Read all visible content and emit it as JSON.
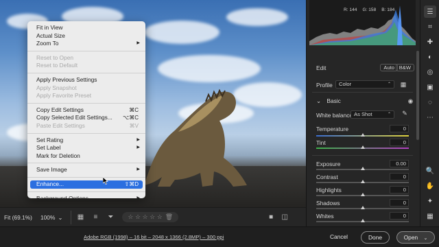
{
  "canvas_bar": {
    "fit_label": "Fit (69.1%)",
    "zoom_label": "100%",
    "rating_stars": "☆ ☆ ☆ ☆ ☆"
  },
  "context_menu": {
    "items": [
      {
        "label": "Fit in View",
        "shortcut": "",
        "submenu": false,
        "disabled": false
      },
      {
        "label": "Actual Size",
        "shortcut": "",
        "submenu": false,
        "disabled": false
      },
      {
        "label": "Zoom To",
        "shortcut": "",
        "submenu": true,
        "disabled": false
      },
      {
        "label": "Reset to Open",
        "shortcut": "",
        "submenu": false,
        "disabled": true
      },
      {
        "label": "Reset to Default",
        "shortcut": "",
        "submenu": false,
        "disabled": true
      },
      {
        "label": "Apply Previous Settings",
        "shortcut": "",
        "submenu": false,
        "disabled": false
      },
      {
        "label": "Apply Snapshot",
        "shortcut": "",
        "submenu": false,
        "disabled": true
      },
      {
        "label": "Apply Favorite Preset",
        "shortcut": "",
        "submenu": false,
        "disabled": true
      },
      {
        "label": "Copy Edit Settings",
        "shortcut": "⌘C",
        "submenu": false,
        "disabled": false
      },
      {
        "label": "Copy Selected Edit Settings...",
        "shortcut": "⌥⌘C",
        "submenu": false,
        "disabled": false
      },
      {
        "label": "Paste Edit Settings",
        "shortcut": "⌘V",
        "submenu": false,
        "disabled": true
      },
      {
        "label": "Set Rating",
        "shortcut": "",
        "submenu": true,
        "disabled": false
      },
      {
        "label": "Set Label",
        "shortcut": "",
        "submenu": true,
        "disabled": false
      },
      {
        "label": "Mark for Deletion",
        "shortcut": "",
        "submenu": false,
        "disabled": false
      },
      {
        "label": "Save Image",
        "shortcut": "",
        "submenu": true,
        "disabled": false
      },
      {
        "label": "Enhance...",
        "shortcut": "⇧⌘D",
        "submenu": false,
        "disabled": false,
        "highlighted": true
      },
      {
        "label": "Background Options",
        "shortcut": "",
        "submenu": true,
        "disabled": false
      }
    ]
  },
  "histogram": {
    "r": "R: 144",
    "g": "G: 158",
    "b": "B: 184"
  },
  "edit_panel": {
    "title": "Edit",
    "auto": "Auto",
    "bw": "B&W",
    "profile_label": "Profile",
    "profile_value": "Color",
    "basic_label": "Basic",
    "white_balance_label": "White balance",
    "white_balance_value": "As Shot",
    "sliders": [
      {
        "label": "Temperature",
        "value": "0",
        "position": 0.5
      },
      {
        "label": "Tint",
        "value": "0",
        "position": 0.5
      },
      {
        "label": "Exposure",
        "value": "0.00",
        "position": 0.5
      },
      {
        "label": "Contrast",
        "value": "0",
        "position": 0.5
      },
      {
        "label": "Highlights",
        "value": "0",
        "position": 0.5
      },
      {
        "label": "Shadows",
        "value": "0",
        "position": 0.5
      },
      {
        "label": "Whites",
        "value": "0",
        "position": 0.5
      }
    ]
  },
  "status": {
    "info": "Adobe RGB (1998) – 16 bit – 2048 x 1366 (2.8MP) – 300 ppi",
    "cancel": "Cancel",
    "done": "Done",
    "open": "Open"
  },
  "colors": {
    "accent": "#2b6fe0",
    "panel": "#262626"
  }
}
